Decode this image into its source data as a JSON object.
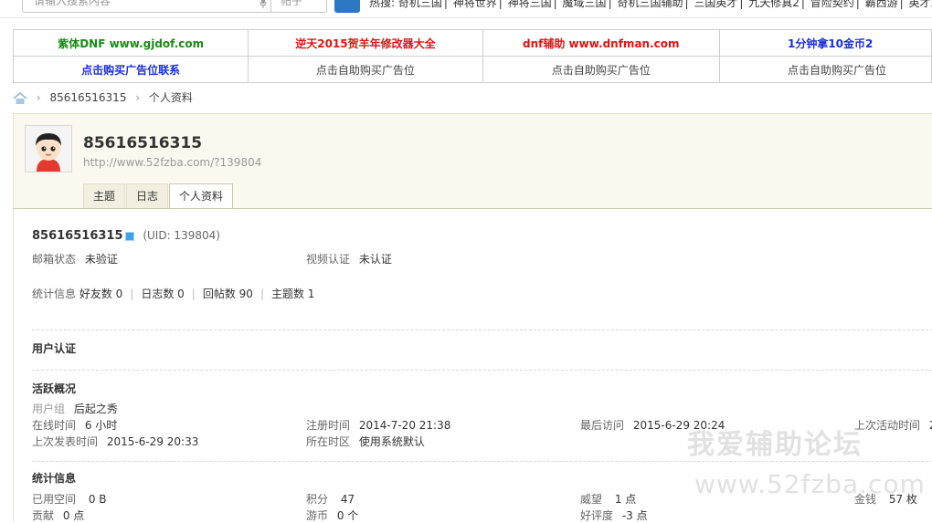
{
  "search": {
    "placeholder": "请输入搜索内容",
    "type_value": "帖子",
    "hot_label": "热搜:",
    "hot_items": [
      "奇机三国",
      "神将世界",
      "神将三国",
      "魔域三国",
      "奇机三国辅助",
      "三国英才",
      "九天修真2",
      "冒险契约",
      "霸西游",
      "英才三国"
    ]
  },
  "ads": {
    "row1": [
      "紫体DNF www.gjdof.com",
      "逆天2015贺羊年修改器大全",
      "dnf辅助 www.dnfman.com",
      "1分钟拿10金币2"
    ],
    "row2": [
      "点击购买广告位联系",
      "点击自助购买广告位",
      "点击自助购买广告位",
      "点击自助购买广告位"
    ]
  },
  "breadcrumb": {
    "items": [
      "85616516315",
      "个人资料"
    ]
  },
  "profile": {
    "username": "85616516315",
    "url": "http://www.52fzba.com/?139804",
    "tabs": [
      "主题",
      "日志",
      "个人资料"
    ],
    "active_tab": "个人资料"
  },
  "info": {
    "username": "85616516315",
    "uid": "(UID: 139804)",
    "email_label": "邮箱状态",
    "email_value": "未验证",
    "video_label": "视频认证",
    "video_value": "未认证",
    "stats_label": "统计信息",
    "friends": "好友数 0",
    "blogs": "日志数 0",
    "replies": "回帖数 90",
    "threads": "主题数 1"
  },
  "auth": {
    "title": "用户认证"
  },
  "activity": {
    "title": "活跃概况",
    "group_label": "用户组",
    "group_value": "后起之秀",
    "online_label": "在线时间",
    "online_value": "6 小时",
    "reg_label": "注册时间",
    "reg_value": "2014-7-20 21:38",
    "last_visit_label": "最后访问",
    "last_visit_value": "2015-6-29 20:24",
    "last_active_label": "上次活动时间",
    "last_active_value": "2",
    "last_post_label": "上次发表时间",
    "last_post_value": "2015-6-29 20:33",
    "zone_label": "所在时区",
    "zone_value": "使用系统默认"
  },
  "stats": {
    "title": "统计信息",
    "space_label": "已用空间",
    "space_value": "0 B",
    "points_label": "积分",
    "points_value": "47",
    "prestige_label": "威望",
    "prestige_value": "1 点",
    "money_label": "金钱",
    "money_value": "57 枚",
    "contrib_label": "贡献",
    "contrib_value": "0 点",
    "coins_label": "游币",
    "coins_value": "0 个",
    "rating_label": "好评度",
    "rating_value": "-3 点"
  },
  "watermark": {
    "title": "我爱辅助论坛",
    "url": "www.52fzba.com"
  }
}
